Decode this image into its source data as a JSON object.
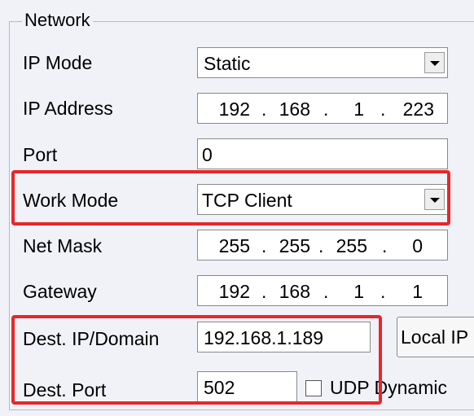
{
  "group": {
    "title": "Network"
  },
  "ip_mode": {
    "label": "IP Mode",
    "value": "Static"
  },
  "ip_address": {
    "label": "IP Address",
    "octets": [
      "192",
      "168",
      "1",
      "223"
    ]
  },
  "port": {
    "label": "Port",
    "value": "0"
  },
  "work_mode": {
    "label": "Work Mode",
    "value": "TCP Client"
  },
  "net_mask": {
    "label": "Net Mask",
    "octets": [
      "255",
      "255",
      "255",
      "0"
    ]
  },
  "gateway": {
    "label": "Gateway",
    "octets": [
      "192",
      "168",
      "1",
      "1"
    ]
  },
  "dest_ip": {
    "label": "Dest. IP/Domain",
    "value": "192.168.1.189"
  },
  "local_ip_button": {
    "label": "Local IP"
  },
  "dest_port": {
    "label": "Dest. Port",
    "value": "502"
  },
  "udp_dynamic": {
    "label": "UDP Dynamic",
    "checked": false
  },
  "colors": {
    "highlight": "#e8262b",
    "panel_bg": "#f1f2f8"
  },
  "ip_separator": "."
}
